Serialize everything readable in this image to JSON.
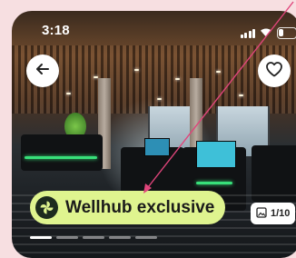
{
  "status_bar": {
    "time": "3:18",
    "battery_level": 0.3
  },
  "header": {
    "back_icon": "arrow-left-icon",
    "favorite_icon": "heart-outline-icon"
  },
  "badge": {
    "label": "Wellhub exclusive",
    "icon": "wellhub-logo-icon",
    "color": "#dff48f"
  },
  "gallery": {
    "counter": "1/10",
    "counter_icon": "image-icon",
    "current_index": 1,
    "total": 10
  },
  "annotation": {
    "color": "#e0457b"
  }
}
